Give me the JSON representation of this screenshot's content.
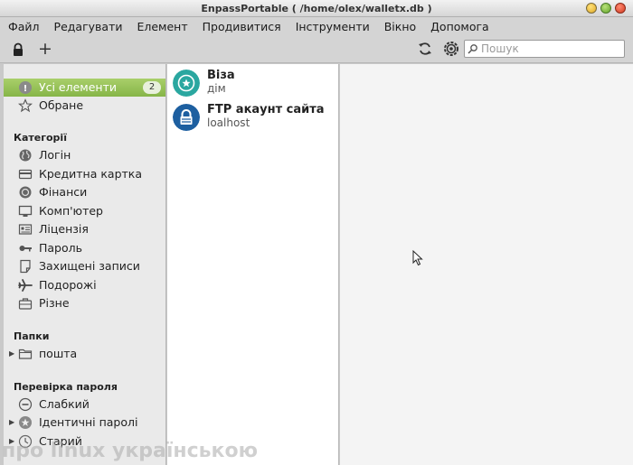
{
  "window": {
    "title": "EnpassPortable ( /home/olex/walletx.db )"
  },
  "menu": [
    "Файл",
    "Редагувати",
    "Елемент",
    "Продивитися",
    "Інструменти",
    "Вікно",
    "Допомога"
  ],
  "toolbar": {
    "search_placeholder": "Пошук"
  },
  "sidebar": {
    "all_items": {
      "label": "Усі елементи",
      "count": "2"
    },
    "favorites": {
      "label": "Обране"
    },
    "categories_heading": "Категорії",
    "categories": [
      "Логін",
      "Кредитна картка",
      "Фінанси",
      "Комп'ютер",
      "Ліцензія",
      "Пароль",
      "Захищені записи",
      "Подорожі",
      "Різне"
    ],
    "folders_heading": "Папки",
    "folders": [
      "пошта"
    ],
    "audit_heading": "Перевірка пароля",
    "audit": [
      "Слабкий",
      "Ідентичні паролі",
      "Старий"
    ]
  },
  "items": [
    {
      "name": "Віза",
      "subtitle": "дім",
      "color": "#2aa7a0"
    },
    {
      "name": "FTP акаунт сайта",
      "subtitle": "loalhost",
      "color": "#1d5fa0"
    }
  ],
  "watermark": "про linux українською"
}
